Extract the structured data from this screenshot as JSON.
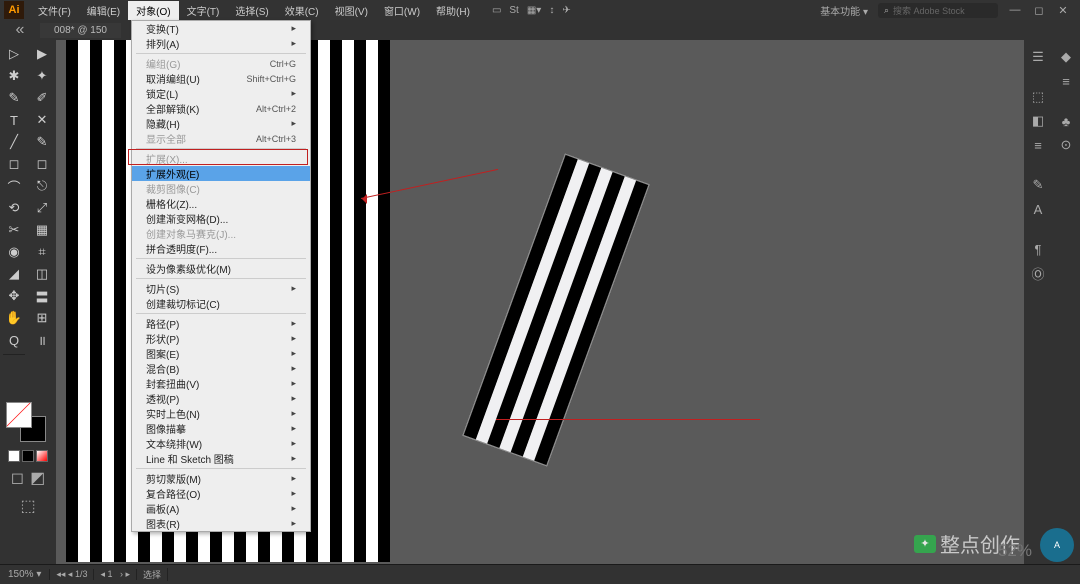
{
  "app_logo": "Ai",
  "menus": [
    "文件(F)",
    "编辑(E)",
    "对象(O)",
    "文字(T)",
    "选择(S)",
    "效果(C)",
    "视图(V)",
    "窗口(W)",
    "帮助(H)"
  ],
  "menu_open_index": 2,
  "workspace_label": "基本功能",
  "search_placeholder": "搜索 Adobe Stock",
  "doc_tab": "008* @ 150",
  "dropdown": [
    {
      "label": "变换(T)",
      "sub": true
    },
    {
      "label": "排列(A)",
      "sub": true
    },
    {
      "sep": true
    },
    {
      "label": "编组(G)",
      "short": "Ctrl+G",
      "disabled": true
    },
    {
      "label": "取消编组(U)",
      "short": "Shift+Ctrl+G"
    },
    {
      "label": "锁定(L)",
      "sub": true
    },
    {
      "label": "全部解锁(K)",
      "short": "Alt+Ctrl+2"
    },
    {
      "label": "隐藏(H)",
      "sub": true
    },
    {
      "label": "显示全部",
      "short": "Alt+Ctrl+3",
      "disabled": true
    },
    {
      "sep": true
    },
    {
      "label": "扩展(X)...",
      "disabled": true
    },
    {
      "label": "扩展外观(E)",
      "highlighted": true
    },
    {
      "label": "裁剪图像(C)",
      "disabled": true
    },
    {
      "label": "栅格化(Z)...",
      "sub": false
    },
    {
      "label": "创建渐变网格(D)..."
    },
    {
      "label": "创建对象马赛克(J)...",
      "disabled": true
    },
    {
      "label": "拼合透明度(F)..."
    },
    {
      "sep": true
    },
    {
      "label": "设为像素级优化(M)"
    },
    {
      "sep": true
    },
    {
      "label": "切片(S)",
      "sub": true
    },
    {
      "label": "创建裁切标记(C)"
    },
    {
      "sep": true
    },
    {
      "label": "路径(P)",
      "sub": true
    },
    {
      "label": "形状(P)",
      "sub": true
    },
    {
      "label": "图案(E)",
      "sub": true
    },
    {
      "label": "混合(B)",
      "sub": true
    },
    {
      "label": "封套扭曲(V)",
      "sub": true
    },
    {
      "label": "透视(P)",
      "sub": true
    },
    {
      "label": "实时上色(N)",
      "sub": true
    },
    {
      "label": "图像描摹",
      "sub": true
    },
    {
      "label": "文本绕排(W)",
      "sub": true
    },
    {
      "label": "Line 和 Sketch 图稿",
      "sub": true
    },
    {
      "sep": true
    },
    {
      "label": "剪切蒙版(M)",
      "sub": true
    },
    {
      "label": "复合路径(O)",
      "sub": true
    },
    {
      "label": "画板(A)",
      "sub": true
    },
    {
      "label": "图表(R)",
      "sub": true
    }
  ],
  "zoom": "150%",
  "nav1": "1/3",
  "nav2": "1",
  "status_sel": "选择",
  "watermark": "整点创作",
  "pct_overlay": "52%",
  "tools_left": [
    "▷",
    "✱",
    "✎",
    "T",
    "╱",
    "◻",
    "⌒",
    "⟲",
    "✂",
    "◉",
    "◢",
    "✥",
    "✋",
    "Q"
  ],
  "tools_left2": [
    "▶",
    "✦",
    "✐",
    "✕",
    "✎",
    "◻",
    "⎋",
    "⤢",
    "▦",
    "⌗",
    "◫",
    "〓",
    "⊞",
    "॥"
  ],
  "panels_r1": [
    "◆",
    "≡",
    "♣",
    "⊙"
  ],
  "panels_r2": [
    "☰",
    "⬚",
    "◧",
    "≡",
    "✎",
    "A",
    "¶",
    "Ⓞ"
  ],
  "avatar_text": "A"
}
